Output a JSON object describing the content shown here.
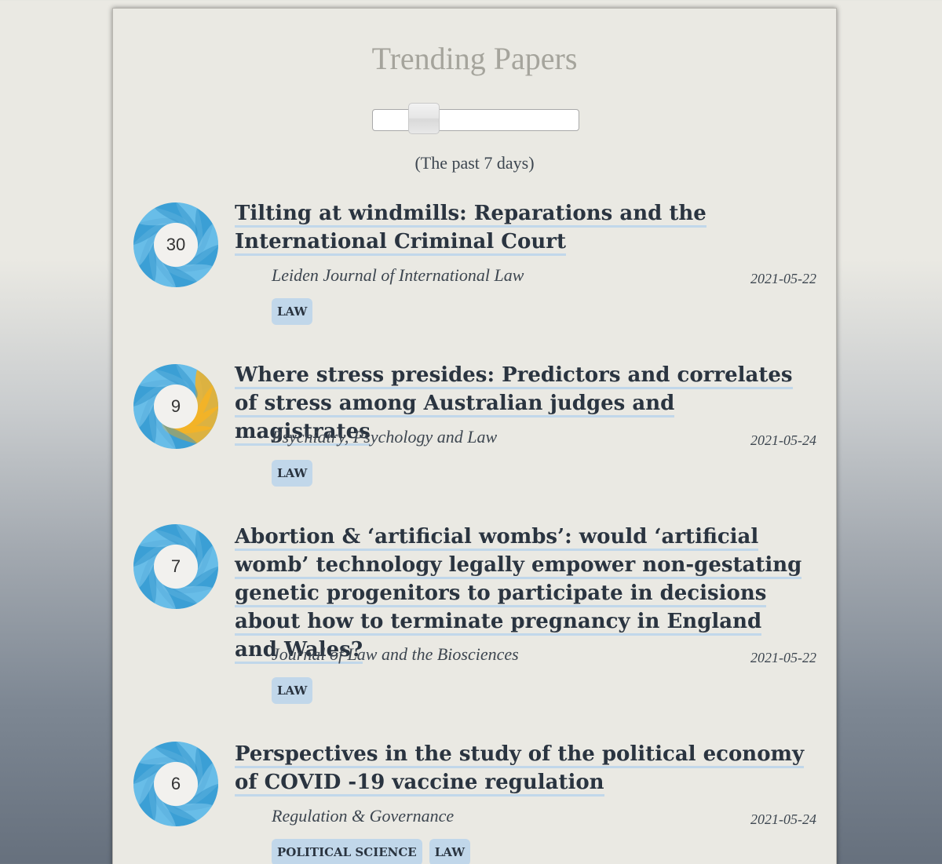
{
  "header": {
    "title": "Trending Papers",
    "period_label": "(The past 7 days)"
  },
  "slider": {
    "position_fraction": 0.18
  },
  "colors": {
    "donut_blue": "#4aaee0",
    "donut_yellow": "#f6b325",
    "tag_bg": "#c1d7ea",
    "title_text": "#2a3440"
  },
  "papers": [
    {
      "score": "30",
      "title": "Tilting at windmills: Reparations and the International Criminal Court",
      "journal": "Leiden Journal of International Law",
      "date": "2021-05-22",
      "tags": [
        "LAW"
      ],
      "donut_colors": [
        "blue"
      ]
    },
    {
      "score": "9",
      "title": "Where stress presides: Predictors and correlates of stress among Australian judges and magistrates",
      "journal": "Psychiatry, Psychology and Law",
      "date": "2021-05-24",
      "tags": [
        "LAW"
      ],
      "donut_colors": [
        "blue",
        "yellow"
      ]
    },
    {
      "score": "7",
      "title": "Abortion & ‘artificial wombs’: would ‘artificial womb’ technology legally empower non-gestating genetic progenitors to participate in decisions about how to terminate pregnancy in England and Wales?",
      "journal": "Journal of Law and the Biosciences",
      "date": "2021-05-22",
      "tags": [
        "LAW"
      ],
      "donut_colors": [
        "blue"
      ]
    },
    {
      "score": "6",
      "title": "Perspectives in the study of the political economy of COVID -19 vaccine regulation",
      "journal": "Regulation & Governance",
      "date": "2021-05-24",
      "tags": [
        "POLITICAL SCIENCE",
        "LAW"
      ],
      "donut_colors": [
        "blue"
      ]
    }
  ]
}
